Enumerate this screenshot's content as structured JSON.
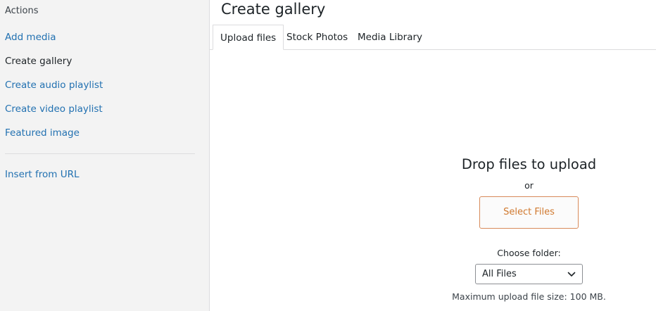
{
  "sidebar": {
    "heading": "Actions",
    "items": [
      {
        "label": "Add media",
        "active": false
      },
      {
        "label": "Create gallery",
        "active": true
      },
      {
        "label": "Create audio playlist",
        "active": false
      },
      {
        "label": "Create video playlist",
        "active": false
      },
      {
        "label": "Featured image",
        "active": false
      }
    ],
    "extra_items": [
      {
        "label": "Insert from URL"
      }
    ]
  },
  "main": {
    "title": "Create gallery",
    "tabs": [
      {
        "label": "Upload files",
        "active": true
      },
      {
        "label": "Stock Photos",
        "active": false
      },
      {
        "label": "Media Library",
        "active": false
      }
    ],
    "uploader": {
      "drop_text": "Drop files to upload",
      "or_text": "or",
      "select_button": "Select Files",
      "folder_label": "Choose folder:",
      "folder_value": "All Files",
      "max_size_text": "Maximum upload file size: 100 MB."
    }
  },
  "colors": {
    "link": "#2271b1",
    "accent_button": "#d0792f",
    "sidebar_bg": "#f3f3f3"
  }
}
